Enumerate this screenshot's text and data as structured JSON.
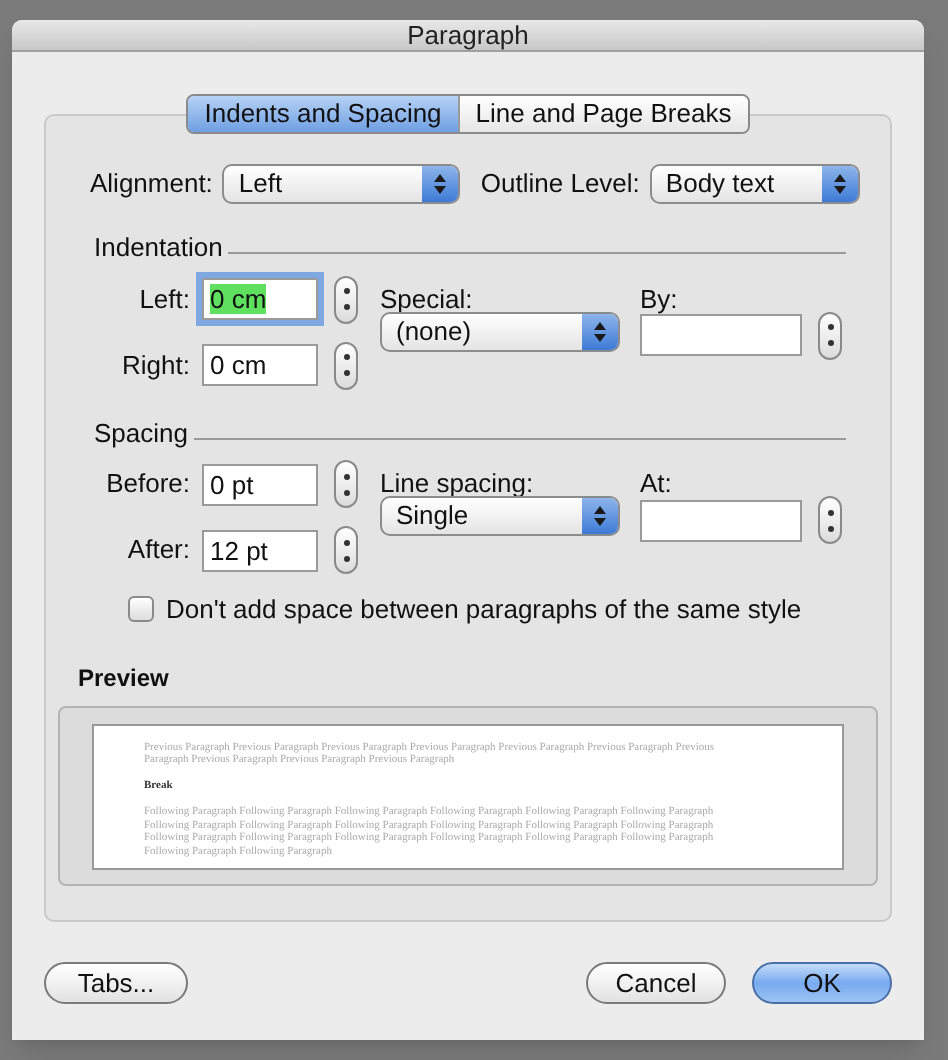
{
  "window": {
    "title": "Paragraph"
  },
  "tabs": [
    {
      "label": "Indents and Spacing",
      "selected": true
    },
    {
      "label": "Line and Page Breaks",
      "selected": false
    }
  ],
  "alignment": {
    "label": "Alignment:",
    "value": "Left"
  },
  "outline_level": {
    "label": "Outline Level:",
    "value": "Body text"
  },
  "indentation": {
    "heading": "Indentation",
    "left": {
      "label": "Left:",
      "value": "0 cm",
      "focused": true
    },
    "right": {
      "label": "Right:",
      "value": "0 cm",
      "focused": false
    },
    "special": {
      "label": "Special:",
      "value": "(none)"
    },
    "by": {
      "label": "By:"
    }
  },
  "spacing": {
    "heading": "Spacing",
    "before": {
      "label": "Before:",
      "value": "0 pt",
      "focused": false
    },
    "after": {
      "label": "After:",
      "value": "12 pt",
      "focused": false
    },
    "line_spacing": {
      "label": "Line spacing:",
      "value": "Single"
    },
    "at": {
      "label": "At:"
    }
  },
  "no_space_checkbox": {
    "label": "Don't add space between paragraphs of the same style",
    "checked": false
  },
  "preview": {
    "label": "Preview",
    "previous_text": "Previous Paragraph Previous Paragraph Previous Paragraph Previous Paragraph Previous Paragraph Previous Paragraph Previous Paragraph Previous Paragraph Previous Paragraph Previous Paragraph",
    "sample_text": "Break",
    "following_text": "Following Paragraph Following Paragraph Following Paragraph Following Paragraph Following Paragraph Following Paragraph Following Paragraph Following Paragraph Following Paragraph Following Paragraph Following Paragraph Following Paragraph Following Paragraph Following Paragraph Following Paragraph Following Paragraph Following Paragraph Following Paragraph Following Paragraph Following Paragraph"
  },
  "buttons": [
    {
      "label": "Tabs...",
      "default": false
    },
    {
      "label": "Cancel",
      "default": false
    },
    {
      "label": "OK",
      "default": true
    }
  ]
}
